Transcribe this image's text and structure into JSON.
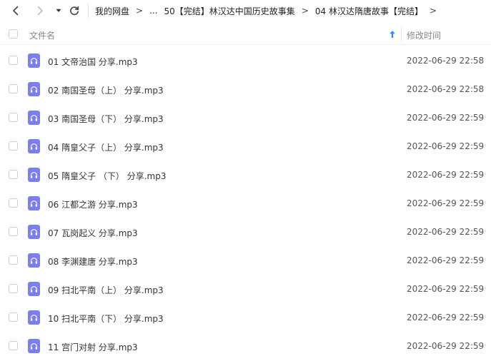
{
  "nav": {
    "back_icon": "chevron-left-icon",
    "forward_icon": "chevron-right-icon",
    "history_icon": "caret-down-icon",
    "refresh_icon": "refresh-icon"
  },
  "breadcrumb": {
    "root": "我的网盘",
    "ellipsis": "...",
    "level1": "50【完结】林汉达中国历史故事集",
    "level2": "04 林汉达隋唐故事【完结】",
    "separator": ">"
  },
  "table": {
    "col_name": "文件名",
    "col_mtime": "修改时间",
    "sort_icon": "sort-ascending-arrow-icon",
    "accent_color": "#2f8cf5"
  },
  "file_icon": {
    "name": "audio-file-icon",
    "color": "#7b7df3"
  },
  "files": [
    {
      "name": "01 文帝治国 分享.mp3",
      "mtime": "2022-06-29 22:58"
    },
    {
      "name": "02 南国圣母（上） 分享.mp3",
      "mtime": "2022-06-29 22:58"
    },
    {
      "name": "03 南国圣母（下） 分享.mp3",
      "mtime": "2022-06-29 22:59"
    },
    {
      "name": "04 隋皇父子（上） 分享.mp3",
      "mtime": "2022-06-29 22:59"
    },
    {
      "name": "05 隋皇父子 （下） 分享.mp3",
      "mtime": "2022-06-29 22:59"
    },
    {
      "name": "06 江都之游 分享.mp3",
      "mtime": "2022-06-29 22:59"
    },
    {
      "name": "07 瓦岗起义 分享.mp3",
      "mtime": "2022-06-29 22:59"
    },
    {
      "name": "08 李渊建唐 分享.mp3",
      "mtime": "2022-06-29 22:59"
    },
    {
      "name": "09 扫北平南（上） 分享.mp3",
      "mtime": "2022-06-29 22:59"
    },
    {
      "name": "10 扫北平南（下） 分享.mp3",
      "mtime": "2022-06-29 22:59"
    },
    {
      "name": "11 宫门对射 分享.mp3",
      "mtime": "2022-06-29 22:59"
    }
  ]
}
